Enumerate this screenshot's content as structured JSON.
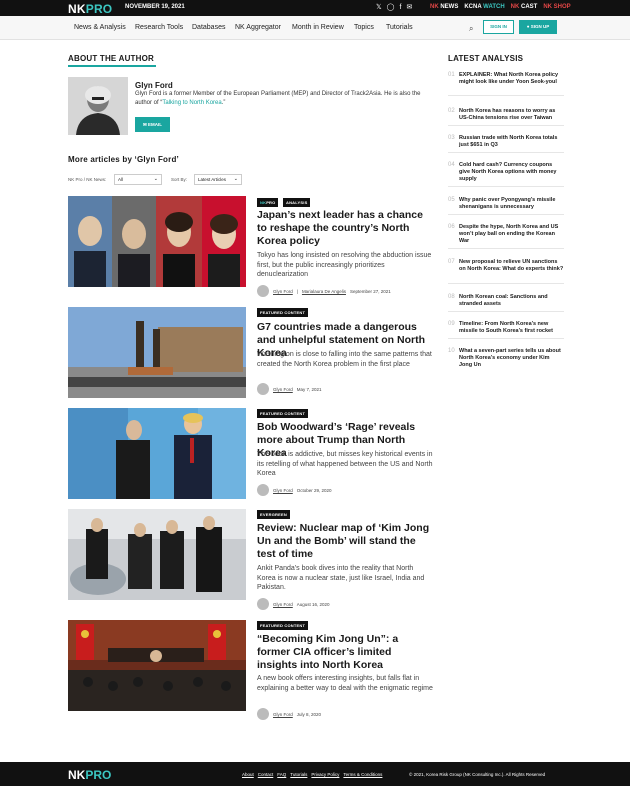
{
  "topbar": {
    "logo_nk": "NK",
    "logo_pro": "PRO",
    "date": "NOVEMBER 19, 2021",
    "icons": [
      "twitter-icon",
      "instagram-icon",
      "facebook-icon",
      "email-icon"
    ],
    "sites": [
      {
        "a": "NK",
        "b": " NEWS"
      },
      {
        "a": "KCNA",
        "b": " WATCH"
      },
      {
        "a": "NK",
        "b": " CAST"
      },
      {
        "a": "NK",
        "b": " SHOP"
      }
    ]
  },
  "nav": {
    "items": [
      "News & Analysis",
      "Research Tools",
      "Databases",
      "NK Aggregator",
      "Month in Review",
      "Topics",
      "Tutorials"
    ],
    "signin": "SIGN IN",
    "signup": "SIGN UP"
  },
  "about": {
    "title": "ABOUT THE AUTHOR",
    "name": "Glyn Ford",
    "bio_before": "Glyn Ford is a former Member of the European Parliament (MEP) and Director of Track2Asia. He is also the author of “",
    "bio_link": "Talking to North Korea",
    "bio_after": ".”",
    "email": "EMAIL"
  },
  "more": {
    "title": "More articles by ‘Glyn Ford’",
    "filter1_label": "NK Pro / NK News:",
    "filter1_value": "All",
    "filter2_label": "Sort By:",
    "filter2_value": "Latest Articles"
  },
  "articles": [
    {
      "badges": [
        {
          "a": "NK",
          "b": "PRO"
        },
        {
          "a": "",
          "b": "ANALYSIS"
        }
      ],
      "title": "Japan’s next leader has a chance to reshape the country’s North Korea policy",
      "excerpt": "Tokyo has long insisted on resolving the abduction issue first, but the public increasingly prioritizes denuclearization",
      "author": "Glyn Ford",
      "coauthor": "Marialaura De Angelis",
      "date": "September 27, 2021"
    },
    {
      "badges": [
        {
          "a": "",
          "b": "FEATURED CONTENT"
        }
      ],
      "title": "G7 countries made a dangerous and unhelpful statement on North Korea",
      "excerpt": "Washington is close to falling into the same patterns that created the North Korea problem in the first place",
      "author": "Glyn Ford",
      "date": "May 7, 2021"
    },
    {
      "badges": [
        {
          "a": "",
          "b": "FEATURED CONTENT"
        }
      ],
      "title": "Bob Woodward’s ‘Rage’ reveals more about Trump than North Korea",
      "excerpt": "The book is addictive, but misses key historical events in its retelling of what happened between the US and North Korea",
      "author": "Glyn Ford",
      "date": "October 29, 2020"
    },
    {
      "badges": [
        {
          "a": "",
          "b": "EVERGREEN"
        }
      ],
      "title": "Review: Nuclear map of ‘Kim Jong Un and the Bomb’ will stand the test of time",
      "excerpt": "Ankit Panda’s book dives into the reality that North Korea is now a nuclear state, just like Israel, India and Pakistan.",
      "author": "Glyn Ford",
      "date": "August 16, 2020"
    },
    {
      "badges": [
        {
          "a": "",
          "b": "FEATURED CONTENT"
        }
      ],
      "title": "“Becoming Kim Jong Un”: a former CIA officer’s limited insights into North Korea",
      "excerpt": "A new book offers interesting insights, but falls flat in explaining a better way to deal with the enigmatic regime",
      "author": "Glyn Ford",
      "date": "July 8, 2020"
    }
  ],
  "latest": {
    "title": "LATEST ANALYSIS",
    "items": [
      {
        "num": "01",
        "text": "EXPLAINER: What North Korea policy might look like under Yoon Seok-youl"
      },
      {
        "num": "02",
        "text": "North Korea has reasons to worry as US-China tensions rise over Taiwan"
      },
      {
        "num": "03",
        "text": "Russian trade with North Korea totals just $651 in Q3"
      },
      {
        "num": "04",
        "text": "Cold hard cash? Currency coupons give North Korea options with money supply"
      },
      {
        "num": "05",
        "text": "Why panic over Pyongyang’s missile shenanigans is unnecessary"
      },
      {
        "num": "06",
        "text": "Despite the hype, North Korea and US won’t play ball on ending the Korean War"
      },
      {
        "num": "07",
        "text": "New proposal to relieve UN sanctions on North Korea: What do experts think?"
      },
      {
        "num": "08",
        "text": "North Korean coal: Sanctions and stranded assets"
      },
      {
        "num": "09",
        "text": "Timeline: From North Korea’s new missile to South Korea’s first rocket"
      },
      {
        "num": "10",
        "text": "What a seven-part series tells us about North Korea’s economy under Kim Jong Un"
      }
    ]
  },
  "footer": {
    "logo_nk": "NK",
    "logo_pro": "PRO",
    "links": [
      "About",
      "Contact",
      "FAQ",
      "Tutorials",
      "Privacy Policy",
      "Terms & Conditions"
    ],
    "copyright": "© 2021, Korea Risk Group (NK Consulting Inc.). All Rights Reserved"
  }
}
